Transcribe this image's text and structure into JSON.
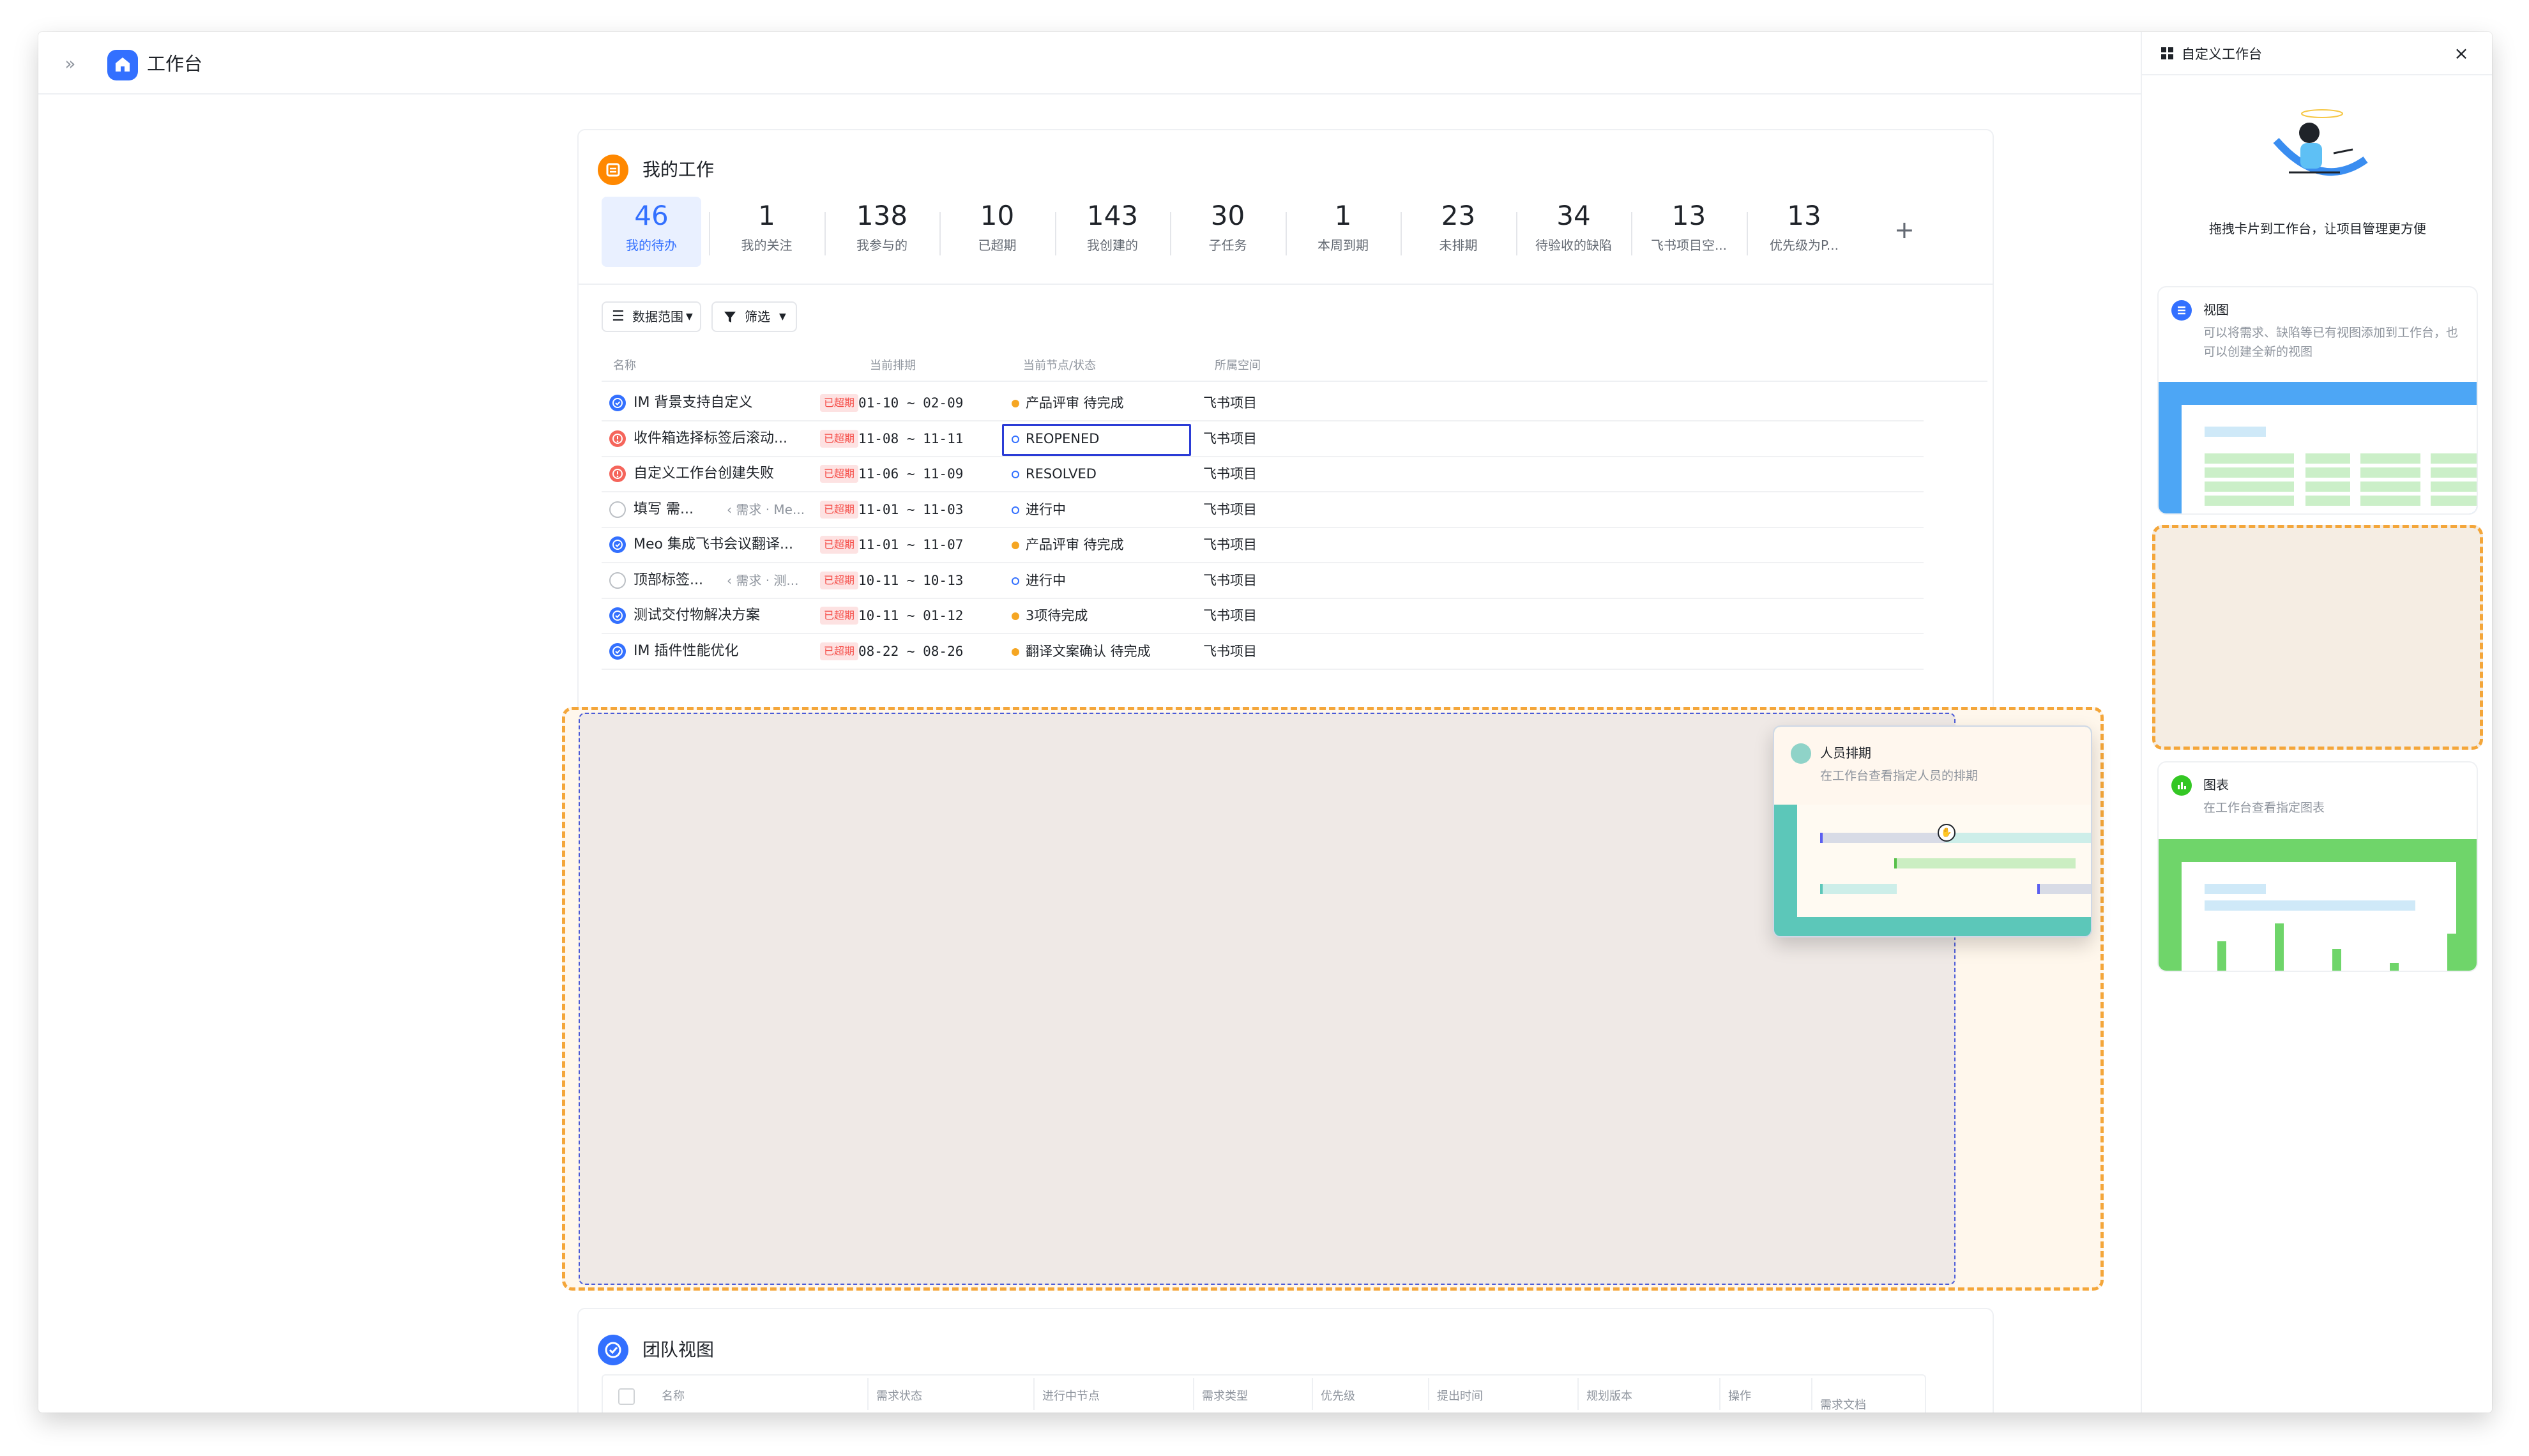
{
  "app": {
    "title": "工作台",
    "expand_icon": "»"
  },
  "my_work": {
    "title": "我的工作",
    "stats": [
      {
        "num": "46",
        "label": "我的待办",
        "active": true
      },
      {
        "num": "1",
        "label": "我的关注"
      },
      {
        "num": "138",
        "label": "我参与的"
      },
      {
        "num": "10",
        "label": "已超期"
      },
      {
        "num": "143",
        "label": "我创建的"
      },
      {
        "num": "30",
        "label": "子任务"
      },
      {
        "num": "1",
        "label": "本周到期"
      },
      {
        "num": "23",
        "label": "未排期"
      },
      {
        "num": "34",
        "label": "待验收的缺陷"
      },
      {
        "num": "13",
        "label": "飞书项目空..."
      },
      {
        "num": "13",
        "label": "优先级为P..."
      }
    ],
    "add_label": "+",
    "filters": {
      "range": "数据范围",
      "filter": "筛选"
    },
    "columns": {
      "name": "名称",
      "schedule": "当前排期",
      "node": "当前节点/状态",
      "space": "所属空间"
    },
    "rows": [
      {
        "name": "IM 背景支持自定义",
        "sub": "",
        "tag": "已超期",
        "date": "01-10 ~ 02-09",
        "node": "产品评审 待完成",
        "dot": "#f5a623",
        "ring": false,
        "space": "飞书项目",
        "icon_color": "#3370ff",
        "icon_type": "check"
      },
      {
        "name": "收件箱选择标签后滚动...",
        "sub": "",
        "tag": "已超期",
        "date": "11-08 ~ 11-11",
        "node": "REOPENED",
        "dot": "#3370ff",
        "ring": true,
        "space": "飞书项目",
        "icon_color": "#f5655b",
        "icon_type": "bug",
        "focused": true
      },
      {
        "name": "自定义工作台创建失败",
        "sub": "",
        "tag": "已超期",
        "date": "11-06 ~ 11-09",
        "node": "RESOLVED",
        "dot": "#3370ff",
        "ring": true,
        "space": "飞书项目",
        "icon_color": "#f5655b",
        "icon_type": "bug"
      },
      {
        "name": "填写 需...",
        "sub": "‹ 需求 · Me...",
        "tag": "已超期",
        "date": "11-01 ~ 11-03",
        "node": "进行中",
        "dot": "#3370ff",
        "ring": true,
        "space": "飞书项目",
        "icon_color": "#bbbfc4",
        "icon_type": "empty"
      },
      {
        "name": "Meo 集成飞书会议翻译...",
        "sub": "",
        "tag": "已超期",
        "date": "11-01 ~ 11-07",
        "node": "产品评审 待完成",
        "dot": "#f5a623",
        "ring": false,
        "space": "飞书项目",
        "icon_color": "#3370ff",
        "icon_type": "check"
      },
      {
        "name": "顶部标签...",
        "sub": "‹ 需求 · 测...",
        "tag": "已超期",
        "date": "10-11 ~ 10-13",
        "node": "进行中",
        "dot": "#3370ff",
        "ring": true,
        "space": "飞书项目",
        "icon_color": "#bbbfc4",
        "icon_type": "empty"
      },
      {
        "name": "测试交付物解决方案",
        "sub": "",
        "tag": "已超期",
        "date": "10-11 ~ 01-12",
        "node": "3项待完成",
        "dot": "#f5a623",
        "ring": false,
        "space": "飞书项目",
        "icon_color": "#3370ff",
        "icon_type": "check"
      },
      {
        "name": "IM 插件性能优化",
        "sub": "",
        "tag": "已超期",
        "date": "08-22 ~ 08-26",
        "node": "翻译文案确认 待完成",
        "dot": "#f5a623",
        "ring": false,
        "space": "飞书项目",
        "icon_color": "#3370ff",
        "icon_type": "check"
      }
    ]
  },
  "dragging_card": {
    "name": "人员排期",
    "desc": "在工作台查看指定人员的排期"
  },
  "team_view": {
    "title": "团队视图",
    "columns": [
      "名称",
      "需求状态",
      "进行中节点",
      "需求类型",
      "优先级",
      "提出时间",
      "规划版本",
      "操作",
      "需求文档"
    ]
  },
  "panel": {
    "title": "自定义工作台",
    "close": "×",
    "subtitle": "拖拽卡片到工作台，让项目管理更方便",
    "templates": [
      {
        "name": "视图",
        "desc": "可以将需求、缺陷等已有视图添加到工作台，也可以创建全新的视图",
        "icon_color": "#3370ff",
        "accent": "#4da6f5"
      },
      {
        "name": "图表",
        "desc": "在工作台查看指定图表",
        "icon_color": "#34c724",
        "accent": "#6fd56a"
      }
    ]
  },
  "colors": {
    "accent": "#3370ff",
    "overdue": "#f54a45",
    "drop_border": "#f4a63a",
    "orange_icon": "#ff8800"
  }
}
